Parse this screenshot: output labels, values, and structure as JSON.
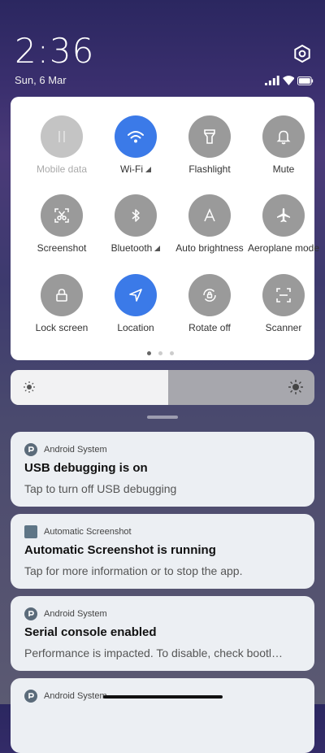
{
  "status_bar": {
    "time": "2:36",
    "date": "Sun, 6 Mar",
    "icons": [
      "signal-icon",
      "wifi-icon",
      "battery-icon"
    ]
  },
  "quick_settings": {
    "tiles": [
      {
        "label": "Mobile data",
        "icon": "mobile-data-icon",
        "state": "disabled"
      },
      {
        "label": "Wi-Fi",
        "icon": "wifi-icon",
        "state": "on",
        "expandable": true
      },
      {
        "label": "Flashlight",
        "icon": "flashlight-icon",
        "state": "off"
      },
      {
        "label": "Mute",
        "icon": "bell-icon",
        "state": "off"
      },
      {
        "label": "Screenshot",
        "icon": "screenshot-icon",
        "state": "off"
      },
      {
        "label": "Bluetooth",
        "icon": "bluetooth-icon",
        "state": "off",
        "expandable": true
      },
      {
        "label": "Auto brightness",
        "icon": "auto-brightness-icon",
        "state": "off"
      },
      {
        "label": "Aeroplane mode",
        "icon": "aeroplane-icon",
        "state": "off"
      },
      {
        "label": "Lock screen",
        "icon": "lock-icon",
        "state": "off"
      },
      {
        "label": "Location",
        "icon": "location-icon",
        "state": "on"
      },
      {
        "label": "Rotate off",
        "icon": "rotate-lock-icon",
        "state": "off"
      },
      {
        "label": "Scanner",
        "icon": "scanner-icon",
        "state": "off"
      }
    ],
    "page_count": 3,
    "current_page": 1
  },
  "brightness": {
    "level": 0.52
  },
  "notifications": [
    {
      "app": "Android System",
      "icon": "android-system-icon",
      "title": "USB debugging is on",
      "body": "Tap to turn off USB debugging"
    },
    {
      "app": "Automatic Screenshot",
      "icon": "automatic-screenshot-icon",
      "title": "Automatic Screenshot is running",
      "body": "Tap for more information or to stop the app."
    },
    {
      "app": "Android System",
      "icon": "android-system-icon",
      "title": "Serial console enabled",
      "body": "Performance is impacted. To disable, check bootl…"
    },
    {
      "app": "Android System",
      "icon": "android-system-icon",
      "title": "",
      "body": ""
    }
  ],
  "colors": {
    "accent_on": "#3b7ae8",
    "tile_off": "#9a9a9a",
    "tile_disabled": "#c4c4c4"
  }
}
